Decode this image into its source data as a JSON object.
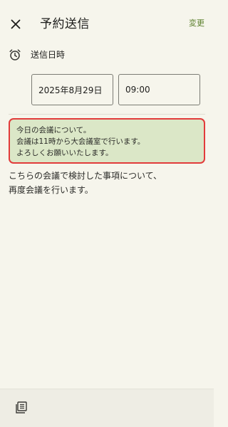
{
  "header": {
    "title": "予約送信",
    "change_label": "変更"
  },
  "schedule": {
    "label": "送信日時",
    "date": "2025年8月29日",
    "time": "09:00"
  },
  "highlight": {
    "lines": [
      "今日の会議について。",
      "会議は11時から大会議室で行います。",
      "よろしくお願いいたします。"
    ]
  },
  "message": {
    "lines": [
      "こちらの会議で検討した事項について、",
      "再度会議を行います。"
    ]
  },
  "colors": {
    "accent": "#5b7f2b",
    "highlight_border": "#e23b3b",
    "highlight_bg": "#dbe7c7",
    "background": "#f6f5ec"
  },
  "icons": {
    "close": "close-icon",
    "clock": "alarm-clock-icon",
    "template": "template-icon"
  }
}
